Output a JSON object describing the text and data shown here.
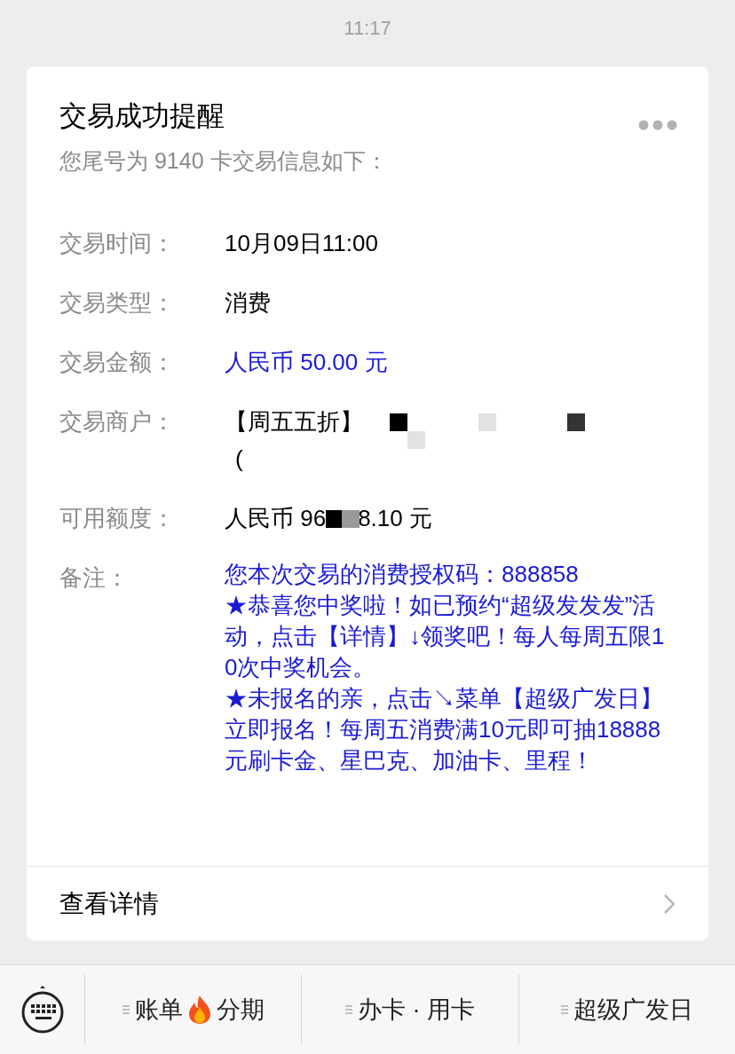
{
  "status_bar": {
    "time": "11:17"
  },
  "card": {
    "title": "交易成功提醒",
    "subtitle": "您尾号为 9140 卡交易信息如下：",
    "rows": [
      {
        "kind": "text",
        "label": "交易时间：",
        "value": "10月09日11:00"
      },
      {
        "kind": "text",
        "label": "交易类型：",
        "value": "消费"
      },
      {
        "kind": "blue",
        "label": "交易金额：",
        "value": "人民币 50.00 元"
      },
      {
        "kind": "merchant",
        "label": "交易商户：",
        "value": "【周五五折】",
        "value_line_2": "("
      },
      {
        "kind": "masked",
        "label": "可用额度：",
        "value": "人民币 96",
        "value_after": "8.10 元"
      },
      {
        "kind": "remarks",
        "label": "备注：",
        "paragraphs": [
          "您本次交易的消费授权码：888858",
          "★恭喜您中奖啦！如已预约“超级发发发”活动，点击【详情】↓领奖吧！每人每周五限10次中奖机会。",
          "★未报名的亲，点击↘菜单【超级广发日】立即报名！每周五消费满10元即可抽18888元刷卡金、星巴克、加油卡、里程！"
        ]
      }
    ],
    "details_link": "查看详情"
  },
  "menu_bar": {
    "items": [
      {
        "kind": "fire",
        "label": "账单",
        "label_after": "分期"
      },
      {
        "kind": "plain",
        "label": "办卡 · 用卡"
      },
      {
        "kind": "plain",
        "label": "超级广发日"
      }
    ]
  }
}
